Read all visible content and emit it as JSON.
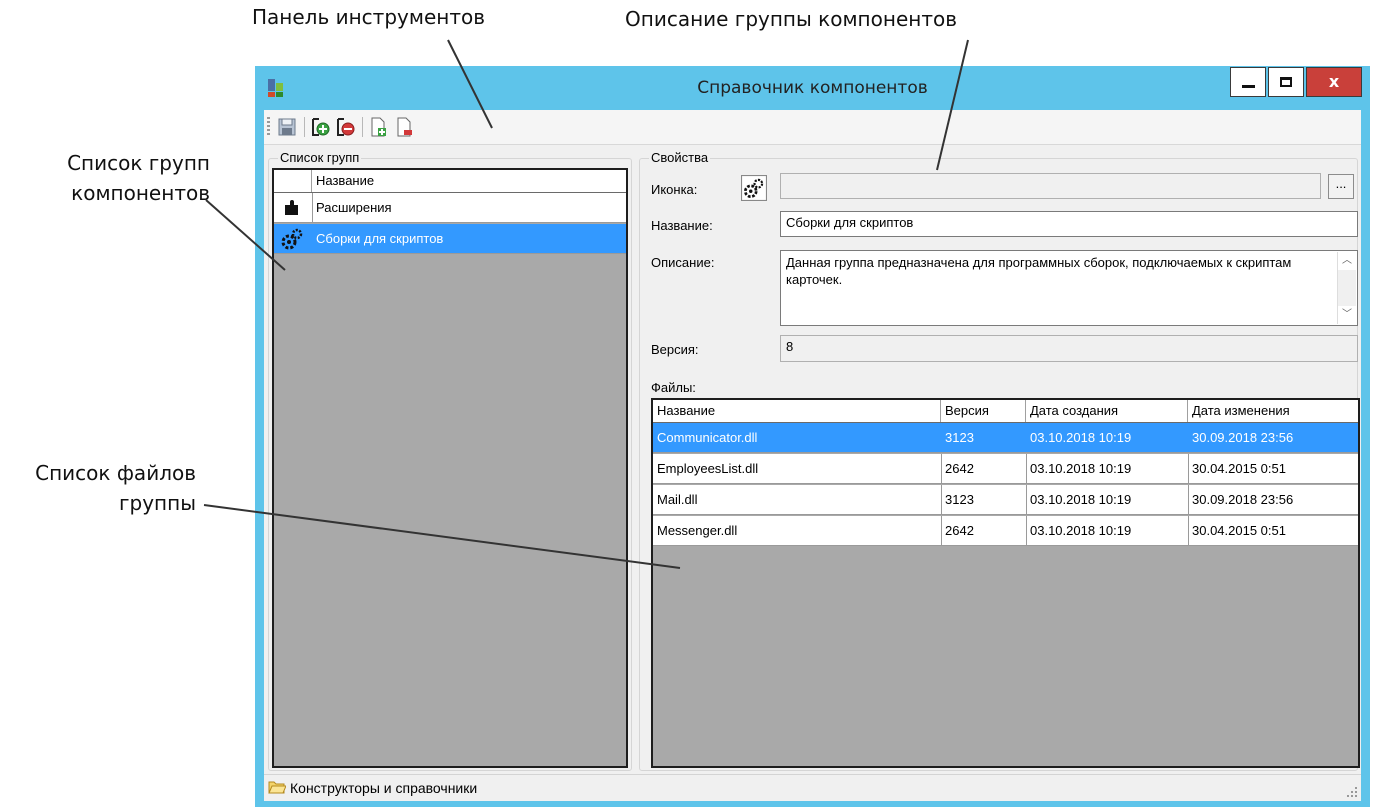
{
  "annotations": {
    "toolbar": "Панель инструментов",
    "group_description": "Описание группы компонентов",
    "group_list_line1": "Список групп",
    "group_list_line2": "компонентов",
    "files_list_line1": "Список файлов",
    "files_list_line2": "группы"
  },
  "window": {
    "title": "Справочник компонентов",
    "close_label": "x"
  },
  "groups": {
    "title": "Список групп",
    "column": "Название",
    "items": [
      {
        "name": "Расширения",
        "icon": "puzzle-icon"
      },
      {
        "name": "Сборки для скриптов",
        "icon": "gears-icon",
        "selected": true
      }
    ]
  },
  "properties": {
    "title": "Свойства",
    "icon_label": "Иконка:",
    "icon_value": "",
    "browse_label": "...",
    "name_label": "Название:",
    "name_value": "Сборки для скриптов",
    "description_label": "Описание:",
    "description_value": "Данная группа предназначена для программных сборок, подключаемых к скриптам карточек.",
    "version_label": "Версия:",
    "version_value": "8",
    "files_label": "Файлы:"
  },
  "files": {
    "columns": [
      "Название",
      "Версия",
      "Дата создания",
      "Дата изменения"
    ],
    "rows": [
      [
        "Communicator.dll",
        "3123",
        "03.10.2018 10:19",
        "30.09.2018 23:56"
      ],
      [
        "EmployeesList.dll",
        "2642",
        "03.10.2018 10:19",
        "30.04.2015 0:51"
      ],
      [
        "Mail.dll",
        "3123",
        "03.10.2018 10:19",
        "30.09.2018 23:56"
      ],
      [
        "Messenger.dll",
        "2642",
        "03.10.2018 10:19",
        "30.04.2015 0:51"
      ]
    ],
    "selected_row": 0
  },
  "status": {
    "text": "Конструкторы и справочники"
  }
}
